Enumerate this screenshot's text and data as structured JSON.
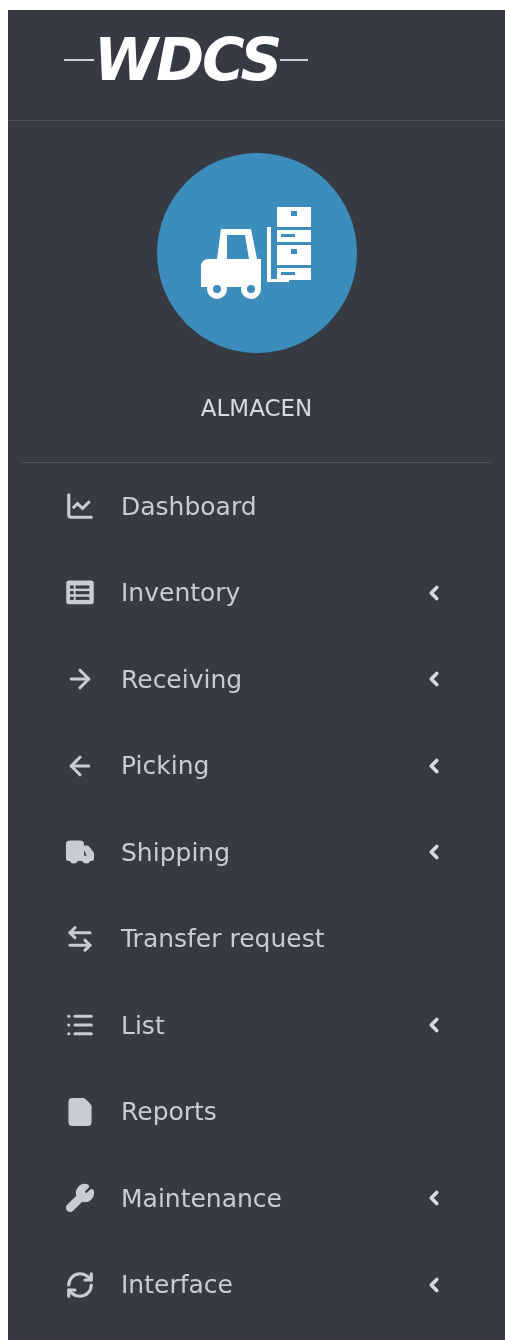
{
  "logo": {
    "text": "WDCS"
  },
  "user": {
    "name": "ALMACEN"
  },
  "menu": [
    {
      "label": "Dashboard",
      "has_submenu": false
    },
    {
      "label": "Inventory",
      "has_submenu": true
    },
    {
      "label": "Receiving",
      "has_submenu": true
    },
    {
      "label": "Picking",
      "has_submenu": true
    },
    {
      "label": "Shipping",
      "has_submenu": true
    },
    {
      "label": "Transfer request",
      "has_submenu": false
    },
    {
      "label": "List",
      "has_submenu": true
    },
    {
      "label": "Reports",
      "has_submenu": false
    },
    {
      "label": "Maintenance",
      "has_submenu": true
    },
    {
      "label": "Interface",
      "has_submenu": true
    }
  ]
}
